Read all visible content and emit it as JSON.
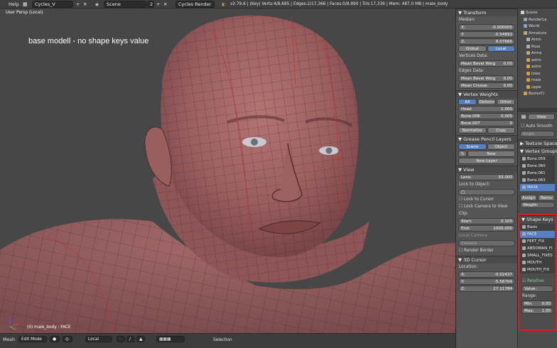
{
  "topbar": {
    "menu_help": "Help",
    "layout": "Cycles_V",
    "scene": "Scene",
    "scene_users": "2",
    "engine": "Cycles Render",
    "stats": "v2.79.6 | (Key) Verts:4/8,685 | Edges:2/17,366 | Faces:0/8,890 | Tris:17,336 | Mem: 487.0 MB | male_body"
  },
  "viewport": {
    "view_label": "User Persp (Local)",
    "caption": "base modell - no shape keys value",
    "object_info": "(0) male_body : FACE"
  },
  "bottombar": {
    "menu_mesh": "Mesh",
    "mode": "Edit Mode",
    "pivot": "Local",
    "layer": "Selection"
  },
  "transform": {
    "title": "Transform",
    "median_label": "Median:",
    "x": {
      "label": "X:",
      "value": "-0.000005"
    },
    "y": {
      "label": "Y:",
      "value": "-0.54893"
    },
    "z": {
      "label": "Z:",
      "value": "8.07666"
    },
    "global": "Global",
    "local": "Local",
    "vertices_data": "Vertices Data:",
    "mean_bevel_1": {
      "label": "Mean Bevel Weig",
      "value": "0.00"
    },
    "edges_data": "Edges Data:",
    "mean_bevel_2": {
      "label": "Mean Bevel Weig",
      "value": "0.00"
    },
    "mean_crease": {
      "label": "Mean Crease:",
      "value": "0.00"
    }
  },
  "vertex_weights": {
    "title": "Vertex Weights",
    "tab_all": "All",
    "tab_deform": "Deform",
    "tab_other": "Other",
    "rows": [
      {
        "name": "Head",
        "value": "1.000"
      },
      {
        "name": "Bone.006",
        "value": "0.005"
      },
      {
        "name": "Bone.007",
        "value": "0"
      }
    ],
    "normalize": "Normalize",
    "copy": "Copy"
  },
  "grease_pencil": {
    "title": "Grease Pencil Layers",
    "tab_scene": "Scene",
    "tab_object": "Object",
    "new": "New",
    "new_layer": "New Layer"
  },
  "view": {
    "title": "View",
    "lens": {
      "label": "Lens:",
      "value": "93.000"
    },
    "lock_to_object": "Lock to Object:",
    "lock_to_cursor": "Lock to Cursor",
    "lock_camera": "Lock Camera to View",
    "clip_label": "Clip:",
    "clip_start": {
      "label": "Start:",
      "value": "0.100"
    },
    "clip_end": {
      "label": "End:",
      "value": "1000.000"
    },
    "local_camera": "Local Camera:",
    "camera": "Camera",
    "render_border": "Render Border"
  },
  "cursor": {
    "title": "3D Cursor",
    "location_label": "Location:",
    "x": {
      "label": "X:",
      "value": "-0.02437"
    },
    "y": {
      "label": "Y:",
      "value": "-5.56704"
    },
    "z": {
      "label": "Z:",
      "value": "27.11784"
    }
  },
  "outliner": {
    "items": [
      {
        "name": "Scene",
        "color": "#cfcfcf"
      },
      {
        "name": "RenderLa",
        "color": "#9aa0a8"
      },
      {
        "name": "World",
        "color": "#7fa8d0"
      },
      {
        "name": "Armature",
        "color": "#c9a96c"
      },
      {
        "name": "Anim",
        "color": "#b0b0b0"
      },
      {
        "name": "Pose",
        "color": "#b0b0b0"
      },
      {
        "name": "Arma",
        "color": "#c9a96c"
      },
      {
        "name": "astro",
        "color": "#e39b3c"
      },
      {
        "name": "astro",
        "color": "#e39b3c"
      },
      {
        "name": "lowe",
        "color": "#e39b3c"
      },
      {
        "name": "male",
        "color": "#e39b3c"
      },
      {
        "name": "uppe",
        "color": "#e39b3c"
      },
      {
        "name": "BezierCi",
        "color": "#e39b3c"
      }
    ]
  },
  "properties": {
    "view_btn": "View",
    "auto_smooth": "Auto Smooth",
    "angle": "Angle",
    "texture_space": "Texture Space",
    "vertex_groups": "Vertex Groups",
    "groups": [
      "Bone.059",
      "Bone.060",
      "Bone.061",
      "Bone.063",
      "MASK"
    ],
    "assign": "Assign",
    "remove": "Remo",
    "weight": "Weight:",
    "shape_keys_title": "Shape Keys",
    "shape_keys": [
      "Basis",
      "FACE",
      "FEET_FIX",
      "ABDOMAN_FI",
      "SMALL_FIXES",
      "MOUTH",
      "MOUTH_FIX"
    ],
    "selected_key": "FACE",
    "relative": "Relative",
    "value_label": "Value:",
    "range_label": "Range:",
    "min": {
      "label": "Min:",
      "value": "0.00"
    },
    "max": {
      "label": "Max:",
      "value": "1.00"
    }
  },
  "colors": {
    "accent": "#5680c2",
    "highlight_box": "#d42020",
    "skin": "#a8686a"
  }
}
